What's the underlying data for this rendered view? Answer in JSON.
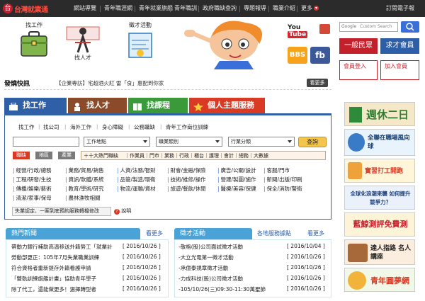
{
  "header": {
    "logo_text": "台灣就業通",
    "nav": [
      "網站導覽",
      "青年職涯網",
      "青年就業旗艦",
      "青年職訓",
      "政府職缺查詢",
      "專題報導",
      "職業介紹",
      "更多"
    ],
    "ebook": "訂閱電子報"
  },
  "banner": {
    "find_job": "找工作",
    "find_talent": "找人才",
    "talent_event": "徵才活動",
    "youtube": "YouTube",
    "bbs": "BBS",
    "fb": "fb"
  },
  "search": {
    "placeholder": "Custom Search",
    "google_label": "Google"
  },
  "members": {
    "general": "一般民眾",
    "member": "求才會員",
    "login": "會員登入",
    "join": "加入會員"
  },
  "flash": {
    "title": "發燒快訊",
    "text": "【企業專訪】宅超酒火紅 雷「食」惠配到你家",
    "more": "看更多"
  },
  "tabs": [
    "找工作",
    "找人才",
    "找課程",
    "個人主題服務"
  ],
  "panel": {
    "sublinks": [
      "找工作",
      "找公司",
      "海外工作",
      "身心障礙",
      "公務職缺",
      "青年工作崗位訓練"
    ],
    "keyword_value": "",
    "work_location": "工作地點",
    "job_category": "職業類別",
    "industry": "行業分類",
    "query": "查詢",
    "pills": [
      "職缺",
      "地區",
      "產業"
    ],
    "hot_label": "十大熱門職缺",
    "hot_items": [
      "作業員",
      "門市",
      "業務",
      "行政",
      "櫃台",
      "護理",
      "會計",
      "總務",
      "大數據"
    ],
    "categories": [
      [
        "經營/行政/總務",
        "業務/貿易/銷售",
        "人資/法務/智財",
        "財會/金融/保險",
        "廣告/公關/設計",
        "客服/門市"
      ],
      [
        "工程/研發/生技",
        "資訊/軟體/系統",
        "品管/製造/環衛",
        "技術/維修/操作",
        "營建/製圖/施作",
        "新聞/出版/印刷"
      ],
      [
        "傳播/娛樂/藝術",
        "教育/學術/研究",
        "物流/運輸/資材",
        "旅遊/餐飲/休閒",
        "醫療/美容/保健",
        "保全/消防/警衛"
      ],
      [
        "清潔/家事/保母",
        "農林漁牧相關"
      ]
    ],
    "notice": "失業認定、一案到底預約服務轉檔修改",
    "help": "說明"
  },
  "news": {
    "title": "熱門新聞",
    "more": "看更多",
    "items": [
      {
        "text": "帶動力銀行補助高溫移送外籍勞工「就業計",
        "date": "[ 2016/10/26 ]"
      },
      {
        "text": "勞動部更正：105年7月失業職業訓練",
        "date": "[ 2016/10/26 ]"
      },
      {
        "text": "符合資格者重新提存外籍看護申請",
        "date": "[ 2016/10/26 ]"
      },
      {
        "text": "「雙軌訓練旗艦計畫」協助青年學子",
        "date": "[ 2016/10/26 ]"
      },
      {
        "text": "除了代工，還能做更多！選擇轉型者",
        "date": "[ 2016/10/26 ]"
      }
    ]
  },
  "events": {
    "title": "徵才活動",
    "local": "各地服務據點",
    "more": "看更多",
    "items": [
      {
        "text": "-敬格(股)公司面試徵才活動",
        "date": "[ 2016/10/04 ]"
      },
      {
        "text": "-大立光電第一徵才活動",
        "date": "[ 2016/10/26 ]"
      },
      {
        "text": "-承億泰規章徵才活動",
        "date": "[ 2016/10/26 ]"
      },
      {
        "text": "-力成科技(股)公司徵才活動",
        "date": "[ 2016/10/26 ]"
      },
      {
        "text": "-105/10/26(三)09:30-11:30萬聖節",
        "date": "[ 2016/10/26 ]"
      }
    ]
  },
  "ads": [
    "週休二日",
    "全聯在職場風向球",
    "實習打工開跑",
    "全球化浪潮來襲 如何提升競爭力？",
    "藍鯨測評免費測",
    "達人指路 名人講座",
    "青年圓夢網"
  ],
  "colors": {
    "brand_red": "#c4202c",
    "tab_blue": "#2f5fa6",
    "tab_brown": "#8b4b2a",
    "tab_green": "#3a9a3a",
    "tab_red": "#d83a24"
  }
}
